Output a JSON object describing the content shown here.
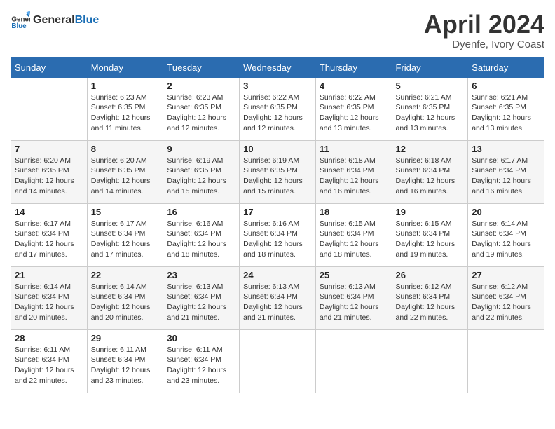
{
  "header": {
    "logo_line1": "General",
    "logo_line2": "Blue",
    "month_year": "April 2024",
    "location": "Dyenfe, Ivory Coast"
  },
  "weekdays": [
    "Sunday",
    "Monday",
    "Tuesday",
    "Wednesday",
    "Thursday",
    "Friday",
    "Saturday"
  ],
  "weeks": [
    [
      {
        "day": "",
        "sunrise": "",
        "sunset": "",
        "daylight": ""
      },
      {
        "day": "1",
        "sunrise": "Sunrise: 6:23 AM",
        "sunset": "Sunset: 6:35 PM",
        "daylight": "Daylight: 12 hours and 11 minutes."
      },
      {
        "day": "2",
        "sunrise": "Sunrise: 6:23 AM",
        "sunset": "Sunset: 6:35 PM",
        "daylight": "Daylight: 12 hours and 12 minutes."
      },
      {
        "day": "3",
        "sunrise": "Sunrise: 6:22 AM",
        "sunset": "Sunset: 6:35 PM",
        "daylight": "Daylight: 12 hours and 12 minutes."
      },
      {
        "day": "4",
        "sunrise": "Sunrise: 6:22 AM",
        "sunset": "Sunset: 6:35 PM",
        "daylight": "Daylight: 12 hours and 13 minutes."
      },
      {
        "day": "5",
        "sunrise": "Sunrise: 6:21 AM",
        "sunset": "Sunset: 6:35 PM",
        "daylight": "Daylight: 12 hours and 13 minutes."
      },
      {
        "day": "6",
        "sunrise": "Sunrise: 6:21 AM",
        "sunset": "Sunset: 6:35 PM",
        "daylight": "Daylight: 12 hours and 13 minutes."
      }
    ],
    [
      {
        "day": "7",
        "sunrise": "Sunrise: 6:20 AM",
        "sunset": "Sunset: 6:35 PM",
        "daylight": "Daylight: 12 hours and 14 minutes."
      },
      {
        "day": "8",
        "sunrise": "Sunrise: 6:20 AM",
        "sunset": "Sunset: 6:35 PM",
        "daylight": "Daylight: 12 hours and 14 minutes."
      },
      {
        "day": "9",
        "sunrise": "Sunrise: 6:19 AM",
        "sunset": "Sunset: 6:35 PM",
        "daylight": "Daylight: 12 hours and 15 minutes."
      },
      {
        "day": "10",
        "sunrise": "Sunrise: 6:19 AM",
        "sunset": "Sunset: 6:35 PM",
        "daylight": "Daylight: 12 hours and 15 minutes."
      },
      {
        "day": "11",
        "sunrise": "Sunrise: 6:18 AM",
        "sunset": "Sunset: 6:34 PM",
        "daylight": "Daylight: 12 hours and 16 minutes."
      },
      {
        "day": "12",
        "sunrise": "Sunrise: 6:18 AM",
        "sunset": "Sunset: 6:34 PM",
        "daylight": "Daylight: 12 hours and 16 minutes."
      },
      {
        "day": "13",
        "sunrise": "Sunrise: 6:17 AM",
        "sunset": "Sunset: 6:34 PM",
        "daylight": "Daylight: 12 hours and 16 minutes."
      }
    ],
    [
      {
        "day": "14",
        "sunrise": "Sunrise: 6:17 AM",
        "sunset": "Sunset: 6:34 PM",
        "daylight": "Daylight: 12 hours and 17 minutes."
      },
      {
        "day": "15",
        "sunrise": "Sunrise: 6:17 AM",
        "sunset": "Sunset: 6:34 PM",
        "daylight": "Daylight: 12 hours and 17 minutes."
      },
      {
        "day": "16",
        "sunrise": "Sunrise: 6:16 AM",
        "sunset": "Sunset: 6:34 PM",
        "daylight": "Daylight: 12 hours and 18 minutes."
      },
      {
        "day": "17",
        "sunrise": "Sunrise: 6:16 AM",
        "sunset": "Sunset: 6:34 PM",
        "daylight": "Daylight: 12 hours and 18 minutes."
      },
      {
        "day": "18",
        "sunrise": "Sunrise: 6:15 AM",
        "sunset": "Sunset: 6:34 PM",
        "daylight": "Daylight: 12 hours and 18 minutes."
      },
      {
        "day": "19",
        "sunrise": "Sunrise: 6:15 AM",
        "sunset": "Sunset: 6:34 PM",
        "daylight": "Daylight: 12 hours and 19 minutes."
      },
      {
        "day": "20",
        "sunrise": "Sunrise: 6:14 AM",
        "sunset": "Sunset: 6:34 PM",
        "daylight": "Daylight: 12 hours and 19 minutes."
      }
    ],
    [
      {
        "day": "21",
        "sunrise": "Sunrise: 6:14 AM",
        "sunset": "Sunset: 6:34 PM",
        "daylight": "Daylight: 12 hours and 20 minutes."
      },
      {
        "day": "22",
        "sunrise": "Sunrise: 6:14 AM",
        "sunset": "Sunset: 6:34 PM",
        "daylight": "Daylight: 12 hours and 20 minutes."
      },
      {
        "day": "23",
        "sunrise": "Sunrise: 6:13 AM",
        "sunset": "Sunset: 6:34 PM",
        "daylight": "Daylight: 12 hours and 21 minutes."
      },
      {
        "day": "24",
        "sunrise": "Sunrise: 6:13 AM",
        "sunset": "Sunset: 6:34 PM",
        "daylight": "Daylight: 12 hours and 21 minutes."
      },
      {
        "day": "25",
        "sunrise": "Sunrise: 6:13 AM",
        "sunset": "Sunset: 6:34 PM",
        "daylight": "Daylight: 12 hours and 21 minutes."
      },
      {
        "day": "26",
        "sunrise": "Sunrise: 6:12 AM",
        "sunset": "Sunset: 6:34 PM",
        "daylight": "Daylight: 12 hours and 22 minutes."
      },
      {
        "day": "27",
        "sunrise": "Sunrise: 6:12 AM",
        "sunset": "Sunset: 6:34 PM",
        "daylight": "Daylight: 12 hours and 22 minutes."
      }
    ],
    [
      {
        "day": "28",
        "sunrise": "Sunrise: 6:11 AM",
        "sunset": "Sunset: 6:34 PM",
        "daylight": "Daylight: 12 hours and 22 minutes."
      },
      {
        "day": "29",
        "sunrise": "Sunrise: 6:11 AM",
        "sunset": "Sunset: 6:34 PM",
        "daylight": "Daylight: 12 hours and 23 minutes."
      },
      {
        "day": "30",
        "sunrise": "Sunrise: 6:11 AM",
        "sunset": "Sunset: 6:34 PM",
        "daylight": "Daylight: 12 hours and 23 minutes."
      },
      {
        "day": "",
        "sunrise": "",
        "sunset": "",
        "daylight": ""
      },
      {
        "day": "",
        "sunrise": "",
        "sunset": "",
        "daylight": ""
      },
      {
        "day": "",
        "sunrise": "",
        "sunset": "",
        "daylight": ""
      },
      {
        "day": "",
        "sunrise": "",
        "sunset": "",
        "daylight": ""
      }
    ]
  ]
}
